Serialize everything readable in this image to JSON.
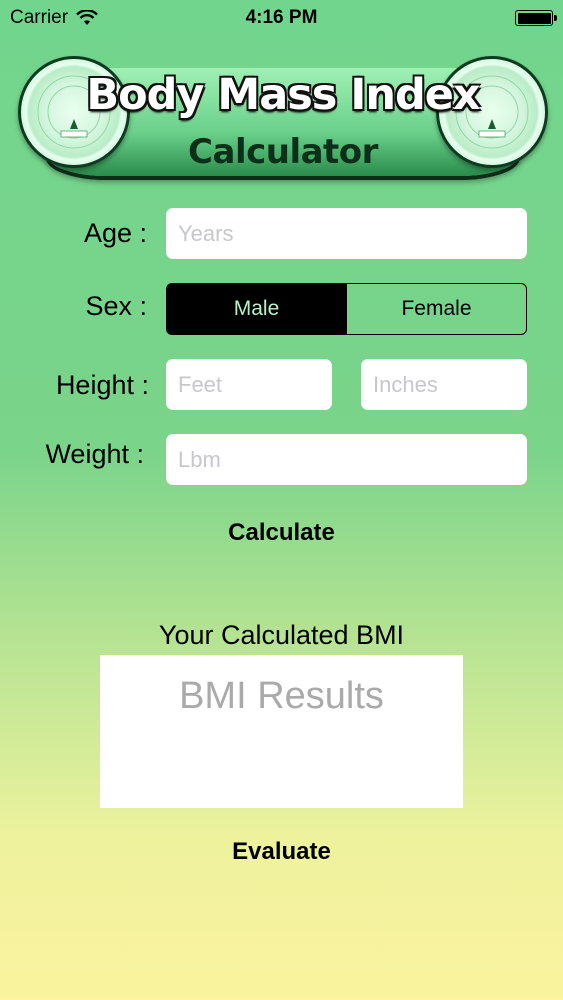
{
  "status_bar": {
    "carrier": "Carrier",
    "time": "4:16 PM",
    "wifi_icon": "wifi-icon",
    "battery_icon": "battery-icon"
  },
  "banner": {
    "title": "Body Mass Index",
    "subtitle": "Calculator",
    "seal_icon": "bmi-wheel-logo"
  },
  "form": {
    "age": {
      "label": "Age :",
      "placeholder": "Years",
      "value": ""
    },
    "sex": {
      "label": "Sex :",
      "options": [
        "Male",
        "Female"
      ],
      "selected": "Male"
    },
    "height": {
      "label": "Height :",
      "feet_placeholder": "Feet",
      "inches_placeholder": "Inches",
      "feet_value": "",
      "inches_value": ""
    },
    "weight": {
      "label": "Weight :",
      "placeholder": "Lbm",
      "value": ""
    },
    "calculate_label": "Calculate"
  },
  "results": {
    "heading": "Your Calculated BMI",
    "placeholder": "BMI Results",
    "evaluate_label": "Evaluate"
  },
  "colors": {
    "background_top": "#72d58d",
    "background_bottom": "#fbf39e",
    "segment_selected_bg": "#000000",
    "segment_selected_text": "#b7f1c8"
  }
}
